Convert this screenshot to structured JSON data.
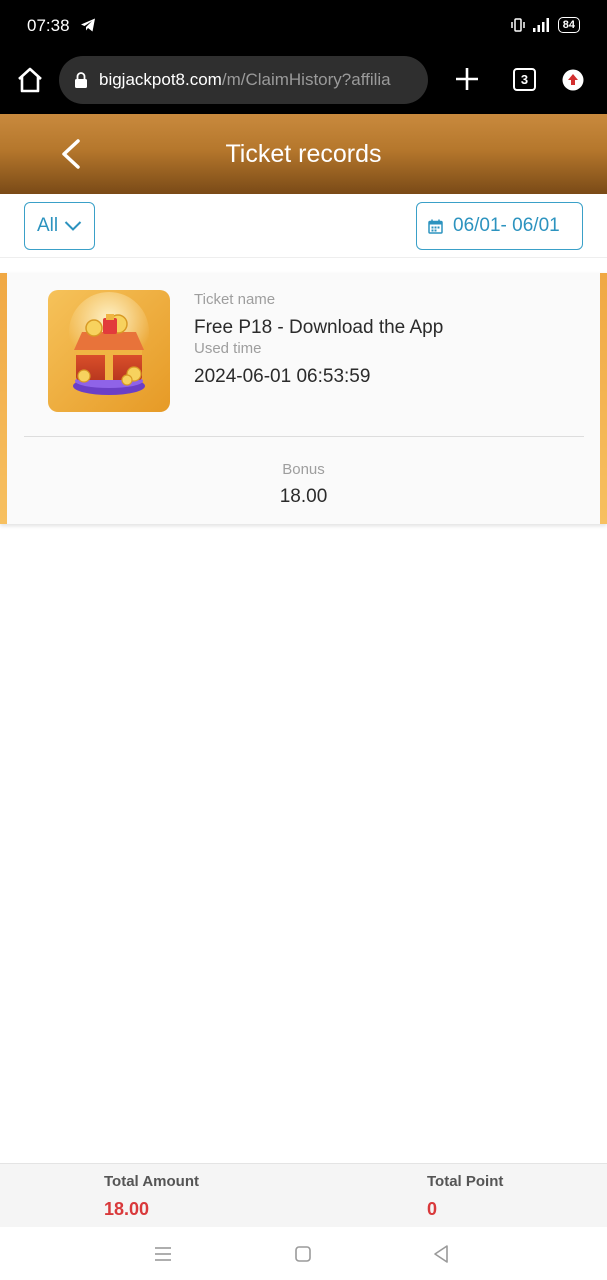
{
  "status_bar": {
    "time": "07:38",
    "battery": "84"
  },
  "browser": {
    "url_domain": "bigjackpot8.com",
    "url_path": "/m/ClaimHistory?affilia",
    "tab_count": "3"
  },
  "header": {
    "title": "Ticket records"
  },
  "filters": {
    "type_selected": "All",
    "date_range": "06/01- 06/01"
  },
  "records": [
    {
      "ticket_name_label": "Ticket name",
      "ticket_name": "Free P18 - Download the App",
      "used_time_label": "Used time",
      "used_time": "2024-06-01 06:53:59",
      "bonus_label": "Bonus",
      "bonus": "18.00"
    }
  ],
  "totals": {
    "amount_label": "Total Amount",
    "amount": "18.00",
    "point_label": "Total Point",
    "point": "0"
  },
  "colors": {
    "accent_blue": "#2c93bf",
    "header_gold": "#b5772c",
    "total_red": "#d9393b",
    "card_stripe": "#f0a844"
  },
  "icons": {
    "status": [
      "telegram-icon",
      "vibrate-icon",
      "signal-icon",
      "battery-icon"
    ],
    "browser": [
      "home-icon",
      "lock-icon",
      "plus-icon",
      "tabs-icon",
      "update-icon"
    ],
    "navigation": [
      "back-chevron-icon",
      "chevron-down-icon",
      "calendar-icon",
      "menu-icon",
      "square-home-icon",
      "triangle-back-icon"
    ]
  }
}
